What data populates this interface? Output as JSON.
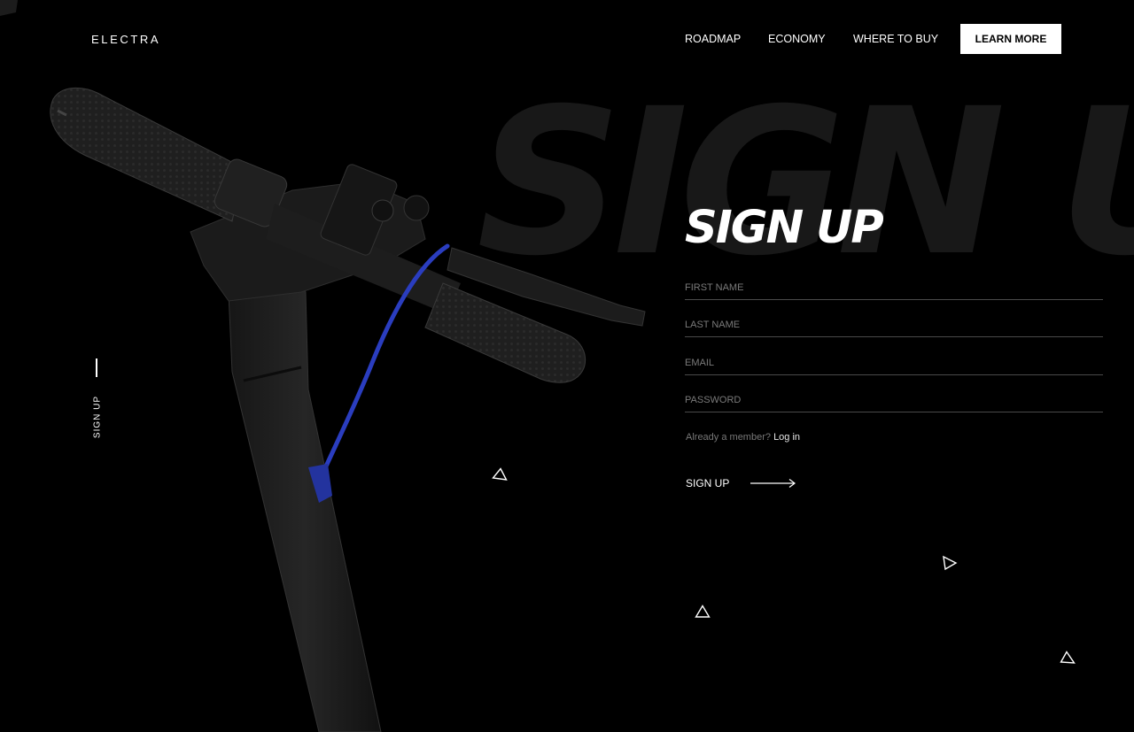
{
  "brand": {
    "logo": "ELECTRA"
  },
  "nav": {
    "links": [
      "ROADMAP",
      "ECONOMY",
      "WHERE TO BUY"
    ],
    "cta": "LEARN MORE"
  },
  "hero": {
    "background_word": "SIGN UP",
    "side_label": "SIGN UP",
    "title": "SIGN UP"
  },
  "form": {
    "fields": [
      {
        "placeholder": "FIRST NAME",
        "value": ""
      },
      {
        "placeholder": "LAST NAME",
        "value": ""
      },
      {
        "placeholder": "EMAIL",
        "value": ""
      },
      {
        "placeholder": "PASSWORD",
        "value": ""
      }
    ],
    "member_text": "Already a member?",
    "login_link": "Log in",
    "submit_label": "SIGN UP"
  },
  "icons": {
    "submit": "arrow-right-icon",
    "decor": [
      "triangle-icon",
      "triangle-icon",
      "triangle-icon",
      "triangle-icon"
    ]
  },
  "colors": {
    "background": "#000000",
    "text": "#ffffff",
    "background_word": "#181818",
    "brake_cable": "#2a3dbf"
  }
}
